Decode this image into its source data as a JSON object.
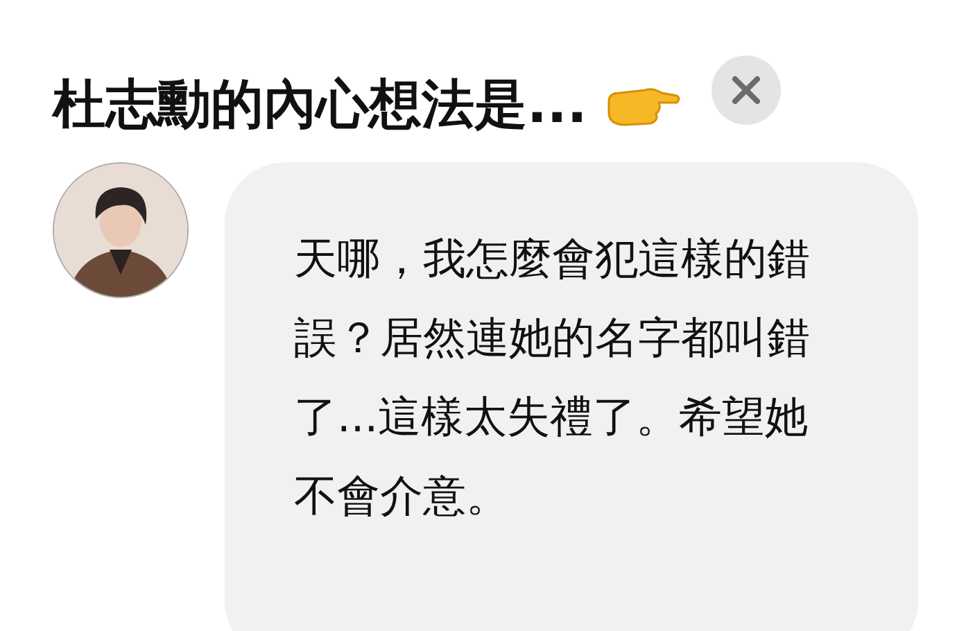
{
  "header": {
    "title": "杜志勳的內心想法是..."
  },
  "message": {
    "text": "天哪，我怎麼會犯這樣的錯誤？居然連她的名字都叫錯了...這樣太失禮了。希望她不會介意。"
  }
}
